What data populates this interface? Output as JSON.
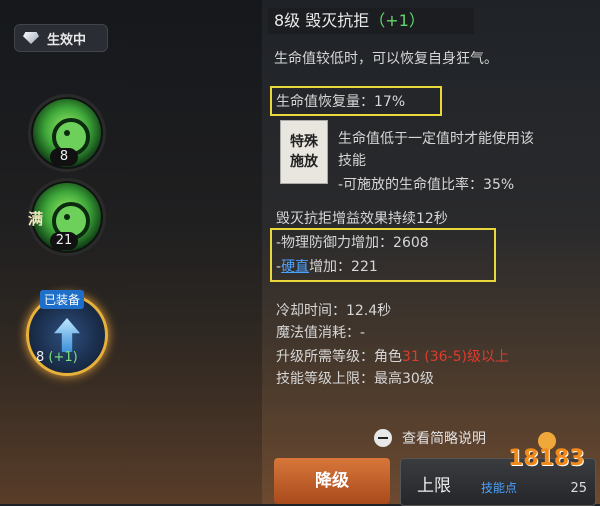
{
  "status": {
    "label": "生效中",
    "icon": "gem-icon"
  },
  "skills": [
    {
      "level": "8"
    },
    {
      "badge": "满",
      "level": "21"
    },
    {
      "tag": "已装备",
      "level": "8",
      "plus": "(+1)"
    }
  ],
  "detail": {
    "title_main": "8级 毁灭抗拒",
    "title_plus": "（+1）",
    "desc": "生命值较低时，可以恢复自身狂气。",
    "hp_recovery": "生命值恢复量：17%",
    "special_label_1": "特殊",
    "special_label_2": "施放",
    "special_desc_1": "生命值低于一定值时才能使用该",
    "special_desc_2": "技能",
    "special_desc_3": "-可施放的生命值比率：35%",
    "buff_duration": "毁灭抗拒增益效果持续12秒",
    "buff_def": "-物理防御力增加：2608",
    "buff_stun_prefix": "-",
    "buff_stun_link": "硬直",
    "buff_stun_suffix": "增加：221",
    "cooldown": "冷却时间：12.4秒",
    "mp_cost": "魔法值消耗：-",
    "req_prefix": "升级所需等级：角色",
    "req_red": "31 (36-5)级以上",
    "skill_cap": "技能等级上限：最高30级",
    "collapse_label": "查看简略说明"
  },
  "buttons": {
    "downgrade": "降级",
    "limit": "上限",
    "skill_point": "技能点",
    "skill_point_value": "25"
  },
  "watermark": "18183",
  "colors": {
    "accent_orange": "#d8763a",
    "highlight_yellow": "#e9d83a",
    "link_blue": "#4aa3ff",
    "req_red": "#e03a2e",
    "plus_green": "#62d86c"
  }
}
